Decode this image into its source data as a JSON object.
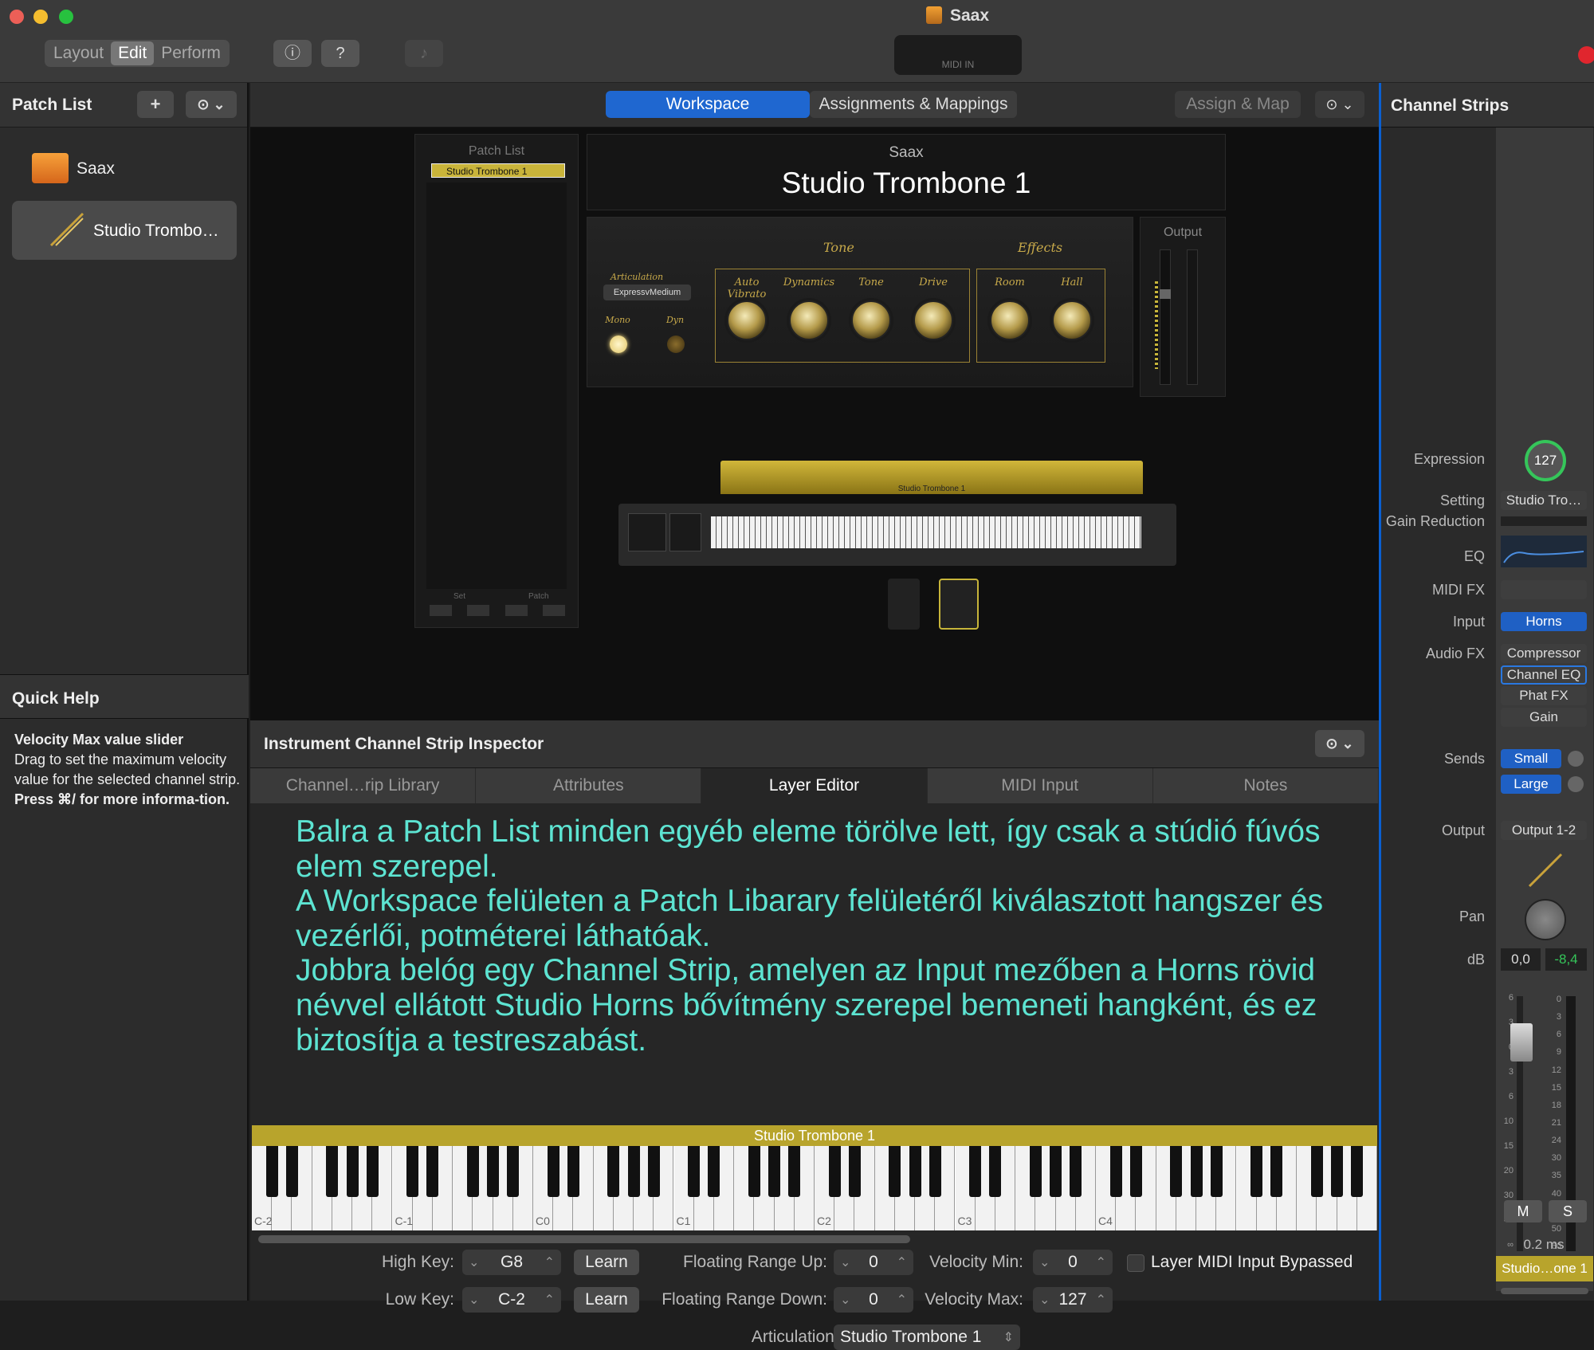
{
  "window": {
    "title": "Saax",
    "midi_label": "MIDI IN"
  },
  "toolbar": {
    "layout": "Layout",
    "edit": "Edit",
    "perform": "Perform",
    "info_icon": "info-icon",
    "help_icon": "help-icon",
    "tuner_icon": "tuner-icon"
  },
  "patch_list": {
    "title": "Patch List",
    "add": "+",
    "action": "⊙ ⌄",
    "items": [
      {
        "label": "Saax",
        "icon": "folder-icon"
      },
      {
        "label": "Studio Trombo…",
        "icon": "trombone-icon"
      }
    ]
  },
  "quick_help": {
    "title": "Quick Help",
    "heading": "Velocity Max value slider",
    "body": "Drag to set the maximum velocity value for the selected channel strip.",
    "shortcut": "Press ⌘/ for more informa-tion."
  },
  "center_tabs": {
    "workspace": "Workspace",
    "assignments": "Assignments & Mappings",
    "assign_map": "Assign & Map",
    "action": "⊙ ⌄"
  },
  "workspace": {
    "patch_list_title": "Patch List",
    "patch_item": "Studio Trombone 1",
    "set": "Set",
    "patch": "Patch",
    "concert": "Saax",
    "patch_name": "Studio Trombone 1",
    "output": "Output",
    "tone_group": "Tone",
    "effects_group": "Effects",
    "articulation_label": "Articulation",
    "articulation_value": "ExpressvMedium",
    "mono": "Mono",
    "dyn": "Dyn",
    "knobs": [
      "Auto Vibrato",
      "Dynamics",
      "Tone",
      "Drive",
      "Room",
      "Hall"
    ],
    "keyboard_label": "Studio Trombone 1"
  },
  "inspector": {
    "title": "Instrument Channel Strip Inspector",
    "action": "⊙ ⌄",
    "tabs": [
      "Channel…rip Library",
      "Attributes",
      "Layer Editor",
      "MIDI Input",
      "Notes"
    ],
    "note": "Balra a Patch List minden egyéb eleme törölve lett, így csak a stúdió fúvós elem szerepel.\nA Workspace felületen a Patch Libarary felületéről kiválasztott hangszer és vezérlői, potméterei láthatóak.\nJobbra belóg egy Channel Strip, amelyen az Input mezőben a Horns rövid névvel ellátott Studio Horns bővítmény szerepel bemeneti hangként, és ez biztosítja a testreszabást.",
    "layer_bar": "Studio Trombone 1",
    "octaves": [
      "C-2",
      "C-1",
      "C0",
      "C1",
      "C2",
      "C3",
      "C4"
    ],
    "high_key_label": "High Key:",
    "high_key": "G8",
    "low_key_label": "Low Key:",
    "low_key": "C-2",
    "learn": "Learn",
    "float_up_label": "Floating Range Up:",
    "float_up": "0",
    "float_down_label": "Floating Range Down:",
    "float_down": "0",
    "vel_min_label": "Velocity Min:",
    "vel_min": "0",
    "vel_max_label": "Velocity Max:",
    "vel_max": "127",
    "bypass_label": "Layer MIDI Input Bypassed",
    "artic_label": "Articulation Set:",
    "artic_value": "Studio Trombone 1"
  },
  "channel_strip": {
    "title": "Channel Strips",
    "expression_label": "Expression",
    "expression": "127",
    "setting_label": "Setting",
    "setting": "Studio Tro…",
    "gain_red_label": "Gain Reduction",
    "eq_label": "EQ",
    "midifx_label": "MIDI FX",
    "input_label": "Input",
    "input": "Horns",
    "audiofx_label": "Audio FX",
    "audiofx": [
      "Compressor",
      "Channel EQ",
      "Phat FX",
      "Gain"
    ],
    "sends_label": "Sends",
    "sends": [
      "Small",
      "Large"
    ],
    "output_label": "Output",
    "output": "Output 1-2",
    "pan_label": "Pan",
    "db_label": "dB",
    "db_value": "0,0",
    "db_peak": "-8,4",
    "fader_scale": [
      "6",
      "3",
      "0",
      "3",
      "6",
      "10",
      "15",
      "20",
      "30",
      "40",
      "∞"
    ],
    "meter_scale": [
      "0",
      "3",
      "6",
      "9",
      "12",
      "15",
      "18",
      "21",
      "24",
      "30",
      "35",
      "40",
      "45",
      "50",
      "60"
    ],
    "mute": "M",
    "solo": "S",
    "latency": "0.2 ms",
    "name": "Studio…one 1"
  }
}
